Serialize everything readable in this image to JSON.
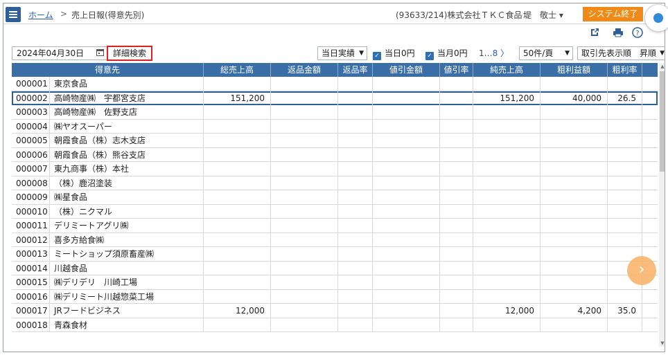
{
  "header": {
    "home": "ホーム",
    "sep": ">",
    "current": "売上日報(得意先別)",
    "company": "(93633/214)株式会社ＴＫＣ食品",
    "user": "堤　敬士 ▾",
    "exit": "システム終了"
  },
  "toolbar": {
    "date": "2024年04月30日",
    "detail_search": "詳細検索",
    "mode": "当日実績",
    "chk_today_zero": "当日0円",
    "chk_month_zero": "当月0円",
    "page_first": "1",
    "page_ellipsis": "…",
    "page_last": "8",
    "page_next": "〉",
    "per_page": "50件/頁",
    "sort": "取引先表示順",
    "order": "昇順"
  },
  "columns": [
    "得意先",
    "総売上高",
    "返品金額",
    "返品率",
    "値引金額",
    "値引率",
    "純売上高",
    "粗利益額",
    "粗利率"
  ],
  "rows": [
    {
      "code": "000001",
      "name": "東京食品",
      "total": "",
      "ret_amt": "",
      "ret_rate": "",
      "disc_amt": "",
      "disc_rate": "",
      "net": "",
      "gross": "",
      "gross_rate": ""
    },
    {
      "code": "000002",
      "name": "高崎物産㈱　宇都宮支店",
      "total": "151,200",
      "ret_amt": "",
      "ret_rate": "",
      "disc_amt": "",
      "disc_rate": "",
      "net": "151,200",
      "gross": "40,000",
      "gross_rate": "26.5"
    },
    {
      "code": "000003",
      "name": "高崎物産㈱　佐野支店",
      "total": "",
      "ret_amt": "",
      "ret_rate": "",
      "disc_amt": "",
      "disc_rate": "",
      "net": "",
      "gross": "",
      "gross_rate": ""
    },
    {
      "code": "000004",
      "name": "㈱ヤオスーパー",
      "total": "",
      "ret_amt": "",
      "ret_rate": "",
      "disc_amt": "",
      "disc_rate": "",
      "net": "",
      "gross": "",
      "gross_rate": ""
    },
    {
      "code": "000005",
      "name": "朝霞食品（株）志木支店",
      "total": "",
      "ret_amt": "",
      "ret_rate": "",
      "disc_amt": "",
      "disc_rate": "",
      "net": "",
      "gross": "",
      "gross_rate": ""
    },
    {
      "code": "000006",
      "name": "朝霞食品（株）熊谷支店",
      "total": "",
      "ret_amt": "",
      "ret_rate": "",
      "disc_amt": "",
      "disc_rate": "",
      "net": "",
      "gross": "",
      "gross_rate": ""
    },
    {
      "code": "000007",
      "name": "東九商事（株）本社",
      "total": "",
      "ret_amt": "",
      "ret_rate": "",
      "disc_amt": "",
      "disc_rate": "",
      "net": "",
      "gross": "",
      "gross_rate": ""
    },
    {
      "code": "000008",
      "name": "（株）鹿沼塗装",
      "total": "",
      "ret_amt": "",
      "ret_rate": "",
      "disc_amt": "",
      "disc_rate": "",
      "net": "",
      "gross": "",
      "gross_rate": ""
    },
    {
      "code": "000009",
      "name": "㈱星食品",
      "total": "",
      "ret_amt": "",
      "ret_rate": "",
      "disc_amt": "",
      "disc_rate": "",
      "net": "",
      "gross": "",
      "gross_rate": ""
    },
    {
      "code": "000010",
      "name": "（株）ニクマル",
      "total": "",
      "ret_amt": "",
      "ret_rate": "",
      "disc_amt": "",
      "disc_rate": "",
      "net": "",
      "gross": "",
      "gross_rate": ""
    },
    {
      "code": "000011",
      "name": "デリミートアグリ㈱",
      "total": "",
      "ret_amt": "",
      "ret_rate": "",
      "disc_amt": "",
      "disc_rate": "",
      "net": "",
      "gross": "",
      "gross_rate": ""
    },
    {
      "code": "000012",
      "name": "喜多方給食㈱",
      "total": "",
      "ret_amt": "",
      "ret_rate": "",
      "disc_amt": "",
      "disc_rate": "",
      "net": "",
      "gross": "",
      "gross_rate": ""
    },
    {
      "code": "000013",
      "name": "ミートショップ須原畜産㈱",
      "total": "",
      "ret_amt": "",
      "ret_rate": "",
      "disc_amt": "",
      "disc_rate": "",
      "net": "",
      "gross": "",
      "gross_rate": ""
    },
    {
      "code": "000014",
      "name": "川越食品",
      "total": "",
      "ret_amt": "",
      "ret_rate": "",
      "disc_amt": "",
      "disc_rate": "",
      "net": "",
      "gross": "",
      "gross_rate": ""
    },
    {
      "code": "000015",
      "name": "㈱デリデリ　川崎工場",
      "total": "",
      "ret_amt": "",
      "ret_rate": "",
      "disc_amt": "",
      "disc_rate": "",
      "net": "",
      "gross": "",
      "gross_rate": ""
    },
    {
      "code": "000016",
      "name": "㈱デリミート川越惣菜工場",
      "total": "",
      "ret_amt": "",
      "ret_rate": "",
      "disc_amt": "",
      "disc_rate": "",
      "net": "",
      "gross": "",
      "gross_rate": ""
    },
    {
      "code": "000017",
      "name": "JRフードビジネス",
      "total": "12,000",
      "ret_amt": "",
      "ret_rate": "",
      "disc_amt": "",
      "disc_rate": "",
      "net": "12,000",
      "gross": "4,200",
      "gross_rate": "35.0"
    },
    {
      "code": "000018",
      "name": "青森食材",
      "total": "",
      "ret_amt": "",
      "ret_rate": "",
      "disc_amt": "",
      "disc_rate": "",
      "net": "",
      "gross": "",
      "gross_rate": ""
    }
  ],
  "selected_row_index": 1,
  "icons": [
    "menu-icon",
    "external-link-icon",
    "print-icon",
    "help-icon",
    "calendar-icon",
    "chevron-right-icon"
  ],
  "colors": {
    "header_blue": "#3a6ea7",
    "exit_orange": "#f08a17",
    "check_blue": "#2f6fb5"
  }
}
